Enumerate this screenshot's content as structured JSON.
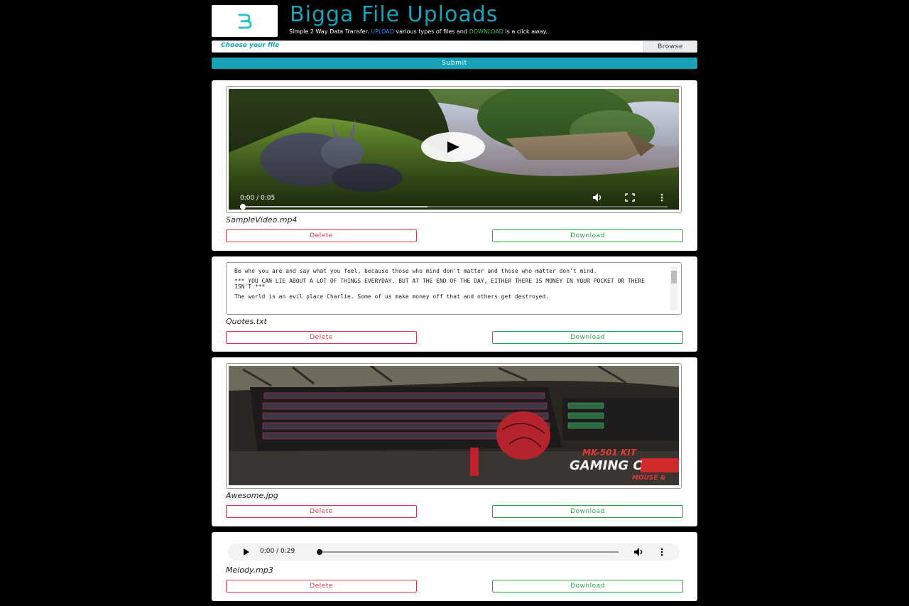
{
  "header": {
    "logo_letter": "B",
    "title": "Bigga File Uploads",
    "tagline_before": "Simple 2 Way Data Transfer. ",
    "tagline_upload": "UPLOAD",
    "tagline_middle": " various types of files and ",
    "tagline_download": "DOWNLOAD",
    "tagline_after": " is a click away."
  },
  "upload": {
    "placeholder": "Choose your file",
    "browse_label": "Browse",
    "submit_label": "Submit"
  },
  "files": [
    {
      "type": "video",
      "name": "SampleVideo.mp4",
      "time": "0:00 / 0:05",
      "delete_label": "Delete",
      "download_label": "Download"
    },
    {
      "type": "text",
      "name": "Quotes.txt",
      "lines": [
        "Be who you are and say what you feel, because those who mind don't matter and those who matter don't mind.",
        "*** YOU CAN LIE ABOUT A LOT OF THINGS EVERYDAY, BUT AT THE END OF THE DAY, EITHER THERE IS MONEY IN YOUR POCKET OR THERE ISN'T ***",
        "The world is an evil place Charlie. Some of us make money off that and others get destroyed."
      ],
      "delete_label": "Delete",
      "download_label": "Download"
    },
    {
      "type": "image",
      "name": "Awesome.jpg",
      "box_text": "MK-501 KIT",
      "box_subtext": "GAMING C",
      "box_subtext2": "MOUSE &",
      "delete_label": "Delete",
      "download_label": "Download"
    },
    {
      "type": "audio",
      "name": "Melody.mp3",
      "time": "0:00 / 0:29",
      "delete_label": "Delete",
      "download_label": "Download"
    }
  ],
  "colors": {
    "accent": "#17a2b8",
    "delete": "#dc3545",
    "download": "#28a745",
    "background": "#000000"
  }
}
